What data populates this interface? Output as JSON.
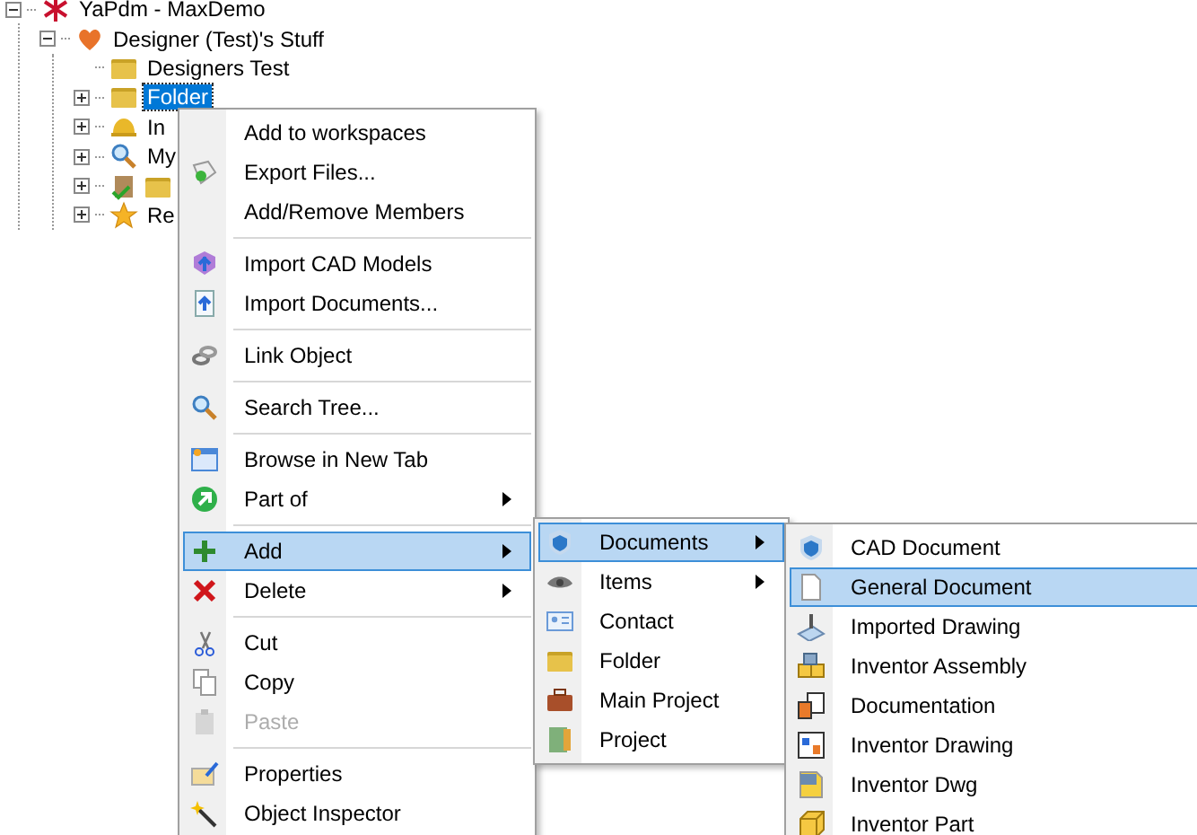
{
  "tree": {
    "label": "YaPdm - MaxDemo",
    "expanded": true,
    "selected": false,
    "children": [
      {
        "label": "Designer (Test)'s Stuff",
        "expanded": true,
        "selected": false,
        "children": [
          {
            "label": "Designers Test",
            "selected": false
          },
          {
            "label": "Folder",
            "expanded": false,
            "selected": true
          },
          {
            "label": "In",
            "expanded": false,
            "selected": false
          },
          {
            "label": "My",
            "expanded": false,
            "selected": false
          },
          {
            "expanded": false,
            "selected": false
          },
          {
            "label": "Re",
            "expanded": false,
            "selected": false
          }
        ]
      }
    ]
  },
  "context_menu": {
    "sections": [
      [
        {
          "label": "Add to workspaces",
          "submenu": false,
          "selected": false,
          "disabled": false
        },
        {
          "label": "Export Files...",
          "submenu": false,
          "selected": false,
          "disabled": false
        },
        {
          "label": "Add/Remove Members",
          "submenu": false,
          "selected": false,
          "disabled": false
        }
      ],
      [
        {
          "label": "Import CAD Models",
          "submenu": false,
          "selected": false,
          "disabled": false
        },
        {
          "label": "Import Documents...",
          "submenu": false,
          "selected": false,
          "disabled": false
        }
      ],
      [
        {
          "label": "Link Object",
          "submenu": false,
          "selected": false,
          "disabled": false
        }
      ],
      [
        {
          "label": "Search Tree...",
          "submenu": false,
          "selected": false,
          "disabled": false
        }
      ],
      [
        {
          "label": "Browse in New Tab",
          "submenu": false,
          "selected": false,
          "disabled": false
        },
        {
          "label": "Part of",
          "submenu": true,
          "selected": false,
          "disabled": false
        }
      ],
      [
        {
          "label": "Add",
          "submenu": true,
          "selected": true,
          "disabled": false
        },
        {
          "label": "Delete",
          "submenu": true,
          "selected": false,
          "disabled": false
        }
      ],
      [
        {
          "label": "Cut",
          "submenu": false,
          "selected": false,
          "disabled": false
        },
        {
          "label": "Copy",
          "submenu": false,
          "selected": false,
          "disabled": false
        },
        {
          "label": "Paste",
          "submenu": false,
          "selected": false,
          "disabled": true
        }
      ],
      [
        {
          "label": "Properties",
          "submenu": false,
          "selected": false,
          "disabled": false
        },
        {
          "label": "Object Inspector",
          "submenu": false,
          "selected": false,
          "disabled": false
        }
      ]
    ]
  },
  "add_submenu": {
    "sections": [
      [
        {
          "label": "Documents",
          "submenu": true,
          "selected": true,
          "disabled": false
        },
        {
          "label": "Items",
          "submenu": true,
          "selected": false,
          "disabled": false
        },
        {
          "label": "Contact",
          "submenu": false,
          "selected": false,
          "disabled": false
        },
        {
          "label": "Folder",
          "submenu": false,
          "selected": false,
          "disabled": false
        },
        {
          "label": "Main Project",
          "submenu": false,
          "selected": false,
          "disabled": false
        },
        {
          "label": "Project",
          "submenu": false,
          "selected": false,
          "disabled": false
        }
      ]
    ]
  },
  "documents_submenu": {
    "sections": [
      [
        {
          "label": "CAD Document",
          "submenu": false,
          "selected": false,
          "disabled": false
        },
        {
          "label": "General Document",
          "submenu": false,
          "selected": true,
          "disabled": false
        },
        {
          "label": "Imported Drawing",
          "submenu": false,
          "selected": false,
          "disabled": false
        },
        {
          "label": "Inventor Assembly",
          "submenu": false,
          "selected": false,
          "disabled": false
        },
        {
          "label": "Documentation",
          "submenu": false,
          "selected": false,
          "disabled": false
        },
        {
          "label": "Inventor Drawing",
          "submenu": false,
          "selected": false,
          "disabled": false
        },
        {
          "label": "Inventor Dwg",
          "submenu": false,
          "selected": false,
          "disabled": false
        },
        {
          "label": "Inventor Part",
          "submenu": false,
          "selected": false,
          "disabled": false
        }
      ]
    ]
  }
}
